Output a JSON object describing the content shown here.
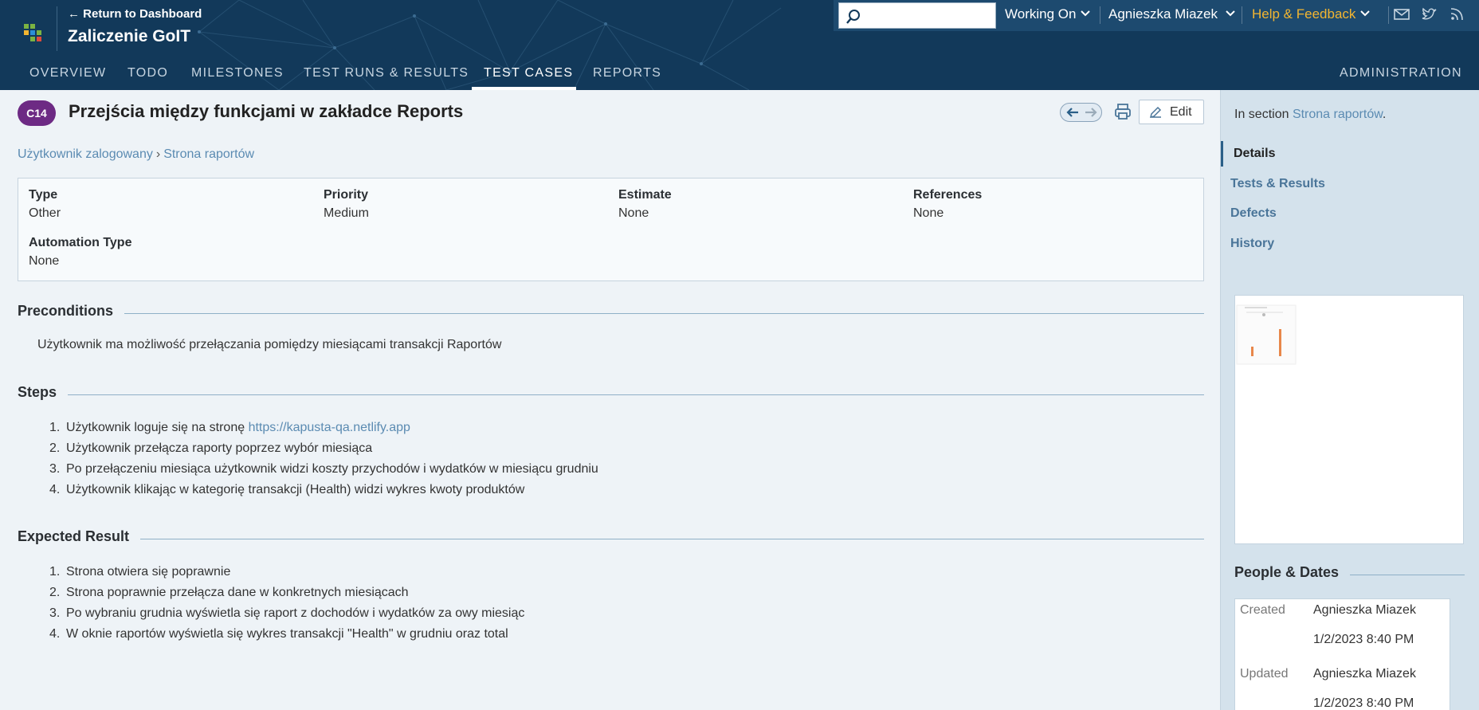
{
  "header": {
    "back_link": "← Return to Dashboard",
    "project_title": "Zaliczenie GoIT",
    "search": {
      "value": "",
      "placeholder": ""
    },
    "working_on": "Working On",
    "user_name": "Agnieszka Miazek",
    "help": "Help & Feedback",
    "icons": [
      "mail-icon",
      "twitter-icon",
      "rss-icon"
    ],
    "colors": {
      "bg": "#12395a",
      "help": "#f2b531"
    }
  },
  "nav": {
    "items": [
      {
        "label": "OVERVIEW"
      },
      {
        "label": "TODO"
      },
      {
        "label": "MILESTONES"
      },
      {
        "label": "TEST RUNS & RESULTS"
      },
      {
        "label": "TEST CASES"
      },
      {
        "label": "REPORTS"
      }
    ],
    "active": "TEST CASES",
    "administration": "ADMINISTRATION"
  },
  "case": {
    "id_badge": "C14",
    "title": "Przejścia między funkcjami w zakładce Reports",
    "edit_label": "Edit",
    "breadcrumb": [
      "Użytkownik zalogowany",
      "Strona raportów"
    ],
    "breadcrumb_sep": "›",
    "fields": [
      {
        "label": "Type",
        "value": "Other"
      },
      {
        "label": "Priority",
        "value": "Medium"
      },
      {
        "label": "Estimate",
        "value": "None"
      },
      {
        "label": "References",
        "value": "None"
      },
      {
        "label": "Automation Type",
        "value": "None"
      }
    ],
    "preconditions": {
      "title": "Preconditions",
      "text": "Użytkownik ma możliwość przełączania pomiędzy miesiącami transakcji Raportów"
    },
    "steps": {
      "title": "Steps",
      "items": [
        {
          "num": "1.",
          "text": "Użytkownik loguje się na stronę ",
          "link": "https://kapusta-qa.netlify.app"
        },
        {
          "num": "2.",
          "text": "Użytkownik przełącza raporty poprzez wybór miesiąca"
        },
        {
          "num": "3.",
          "text": "Po przełączeniu miesiąca użytkownik widzi koszty przychodów i wydatków w miesiącu grudniu"
        },
        {
          "num": "4.",
          "text": "Użytkownik klikając w kategorię transakcji (Health) widzi wykres kwoty produktów"
        }
      ]
    },
    "expected": {
      "title": "Expected Result",
      "items": [
        {
          "num": "1.",
          "text": "Strona otwiera się poprawnie"
        },
        {
          "num": "2.",
          "text": "Strona poprawnie przełącza dane w konkretnych miesiącach"
        },
        {
          "num": "3.",
          "text": "Po wybraniu grudnia wyświetla się raport z dochodów i wydatków za owy miesiąc"
        },
        {
          "num": "4.",
          "text": "W oknie raportów wyświetla się wykres transakcji \"Health\" w grudniu oraz total"
        }
      ]
    }
  },
  "sidebar": {
    "in_section_prefix": "In section ",
    "in_section_link": "Strona raportów",
    "in_section_suffix": ".",
    "nav": [
      {
        "label": "Details"
      },
      {
        "label": "Tests & Results"
      },
      {
        "label": "Defects"
      },
      {
        "label": "History"
      }
    ],
    "active": "Details",
    "people_dates": {
      "title": "People & Dates",
      "created_label": "Created",
      "created_by": "Agnieszka Miazek",
      "created_at": "1/2/2023 8:40 PM",
      "updated_label": "Updated",
      "updated_by": "Agnieszka Miazek",
      "updated_at": "1/2/2023 8:40 PM"
    }
  }
}
